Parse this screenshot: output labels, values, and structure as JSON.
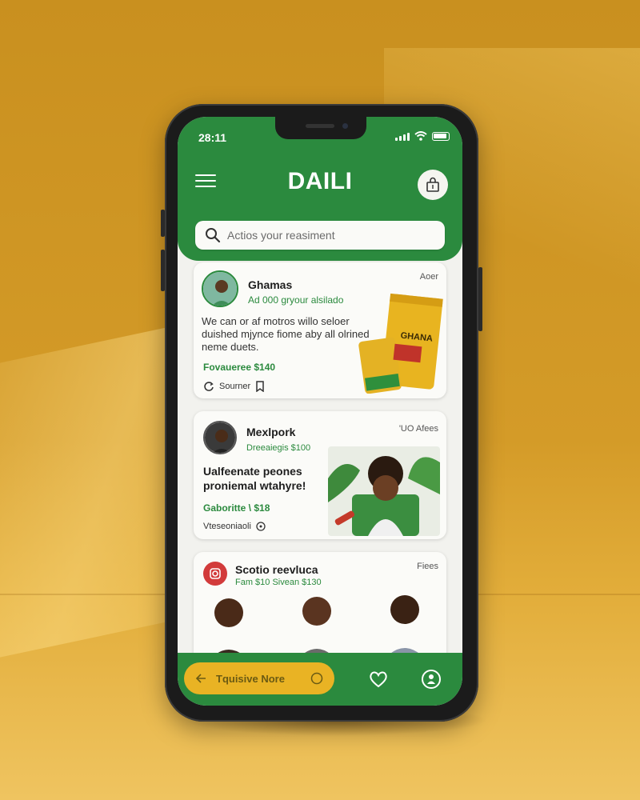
{
  "status_bar": {
    "time": "28:11"
  },
  "header": {
    "title": "DAILI",
    "search_placeholder": "Actios your reasiment"
  },
  "feed": [
    {
      "name": "Ghamas",
      "subtitle": "Ad 000 gryour alsilado",
      "tag": "Aoer",
      "description": "We can or af motros willo seloer duished mjynce fiome aby all olrined neme duets.",
      "price": "Fovaueree $140",
      "footer_label": "Sourner",
      "product_label": "GHANA"
    },
    {
      "name": "Mexlpork",
      "subtitle": "Dreeaiegis $100",
      "tag": "'UO Afees",
      "description": "Ualfeenate peones proniemal wtahyre!",
      "price": "Gaboritte \\ $18",
      "footer_label": "Vteseoniaoli"
    },
    {
      "name": "Scotio reevluca",
      "subtitle": "Fam $10 Sivean $130",
      "tag": "Fiees"
    }
  ],
  "bottom_nav": {
    "cta_label": "Tquisive Nore"
  },
  "colors": {
    "brand_green": "#2b8a3e",
    "accent_yellow": "#e9b324",
    "background": "#d49b28"
  }
}
